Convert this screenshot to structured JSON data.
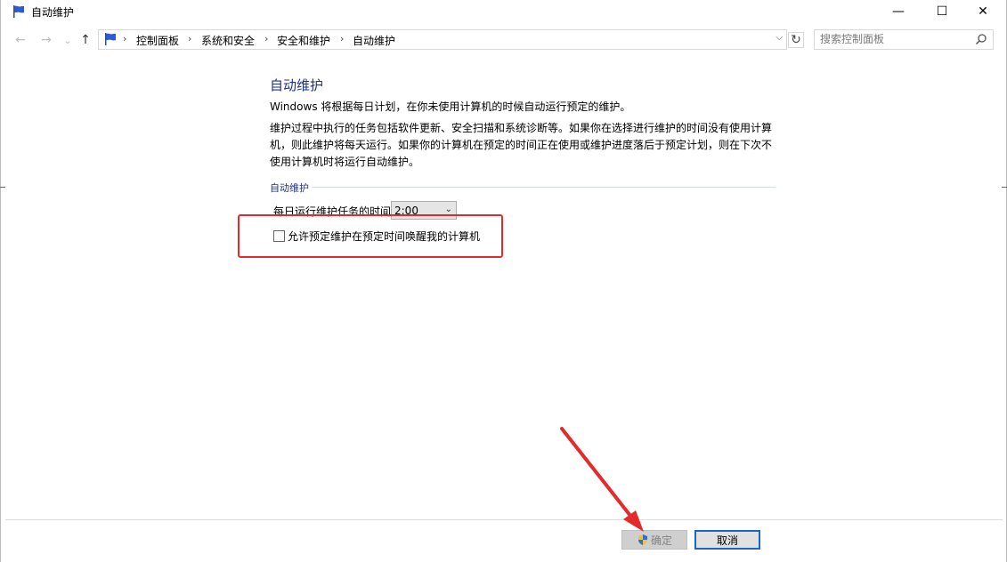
{
  "window": {
    "title": "自动维护",
    "minimize_glyph": "—",
    "maximize_glyph": "☐",
    "close_glyph": "✕"
  },
  "nav": {
    "back_glyph": "←",
    "forward_glyph": "→",
    "recent_glyph": "⌄",
    "up_glyph": "↑",
    "breadcrumbs": [
      "控制面板",
      "系统和安全",
      "安全和维护",
      "自动维护"
    ],
    "separator": "›",
    "refresh_glyph": "↻",
    "search_placeholder": "搜索控制面板"
  },
  "main": {
    "heading": "自动维护",
    "para1": "Windows 将根据每日计划，在你未使用计算机的时候自动运行预定的维护。",
    "para2": "维护过程中执行的任务包括软件更新、安全扫描和系统诊断等。如果你在选择进行维护的时间没有使用计算机，则此维护将每天运行。如果你的计算机在预定的时间正在使用或维护进度落后于预定计划，则在下次不使用计算机时将运行自动维护。",
    "group_label": "自动维护",
    "time_label": "每日运行维护任务的时间",
    "time_value": "2:00",
    "wake_label": "允许预定维护在预定时间唤醒我的计算机",
    "wake_checked": false
  },
  "footer": {
    "ok_label": "确定",
    "cancel_label": "取消"
  },
  "colors": {
    "heading": "#1e3287",
    "highlight_box": "#e52a2a",
    "annotation_arrow": "#e52a2a",
    "focus_border": "#1e63c6"
  },
  "icons": {
    "app": "flag-icon",
    "search": "search-icon",
    "ok": "shield-icon"
  }
}
